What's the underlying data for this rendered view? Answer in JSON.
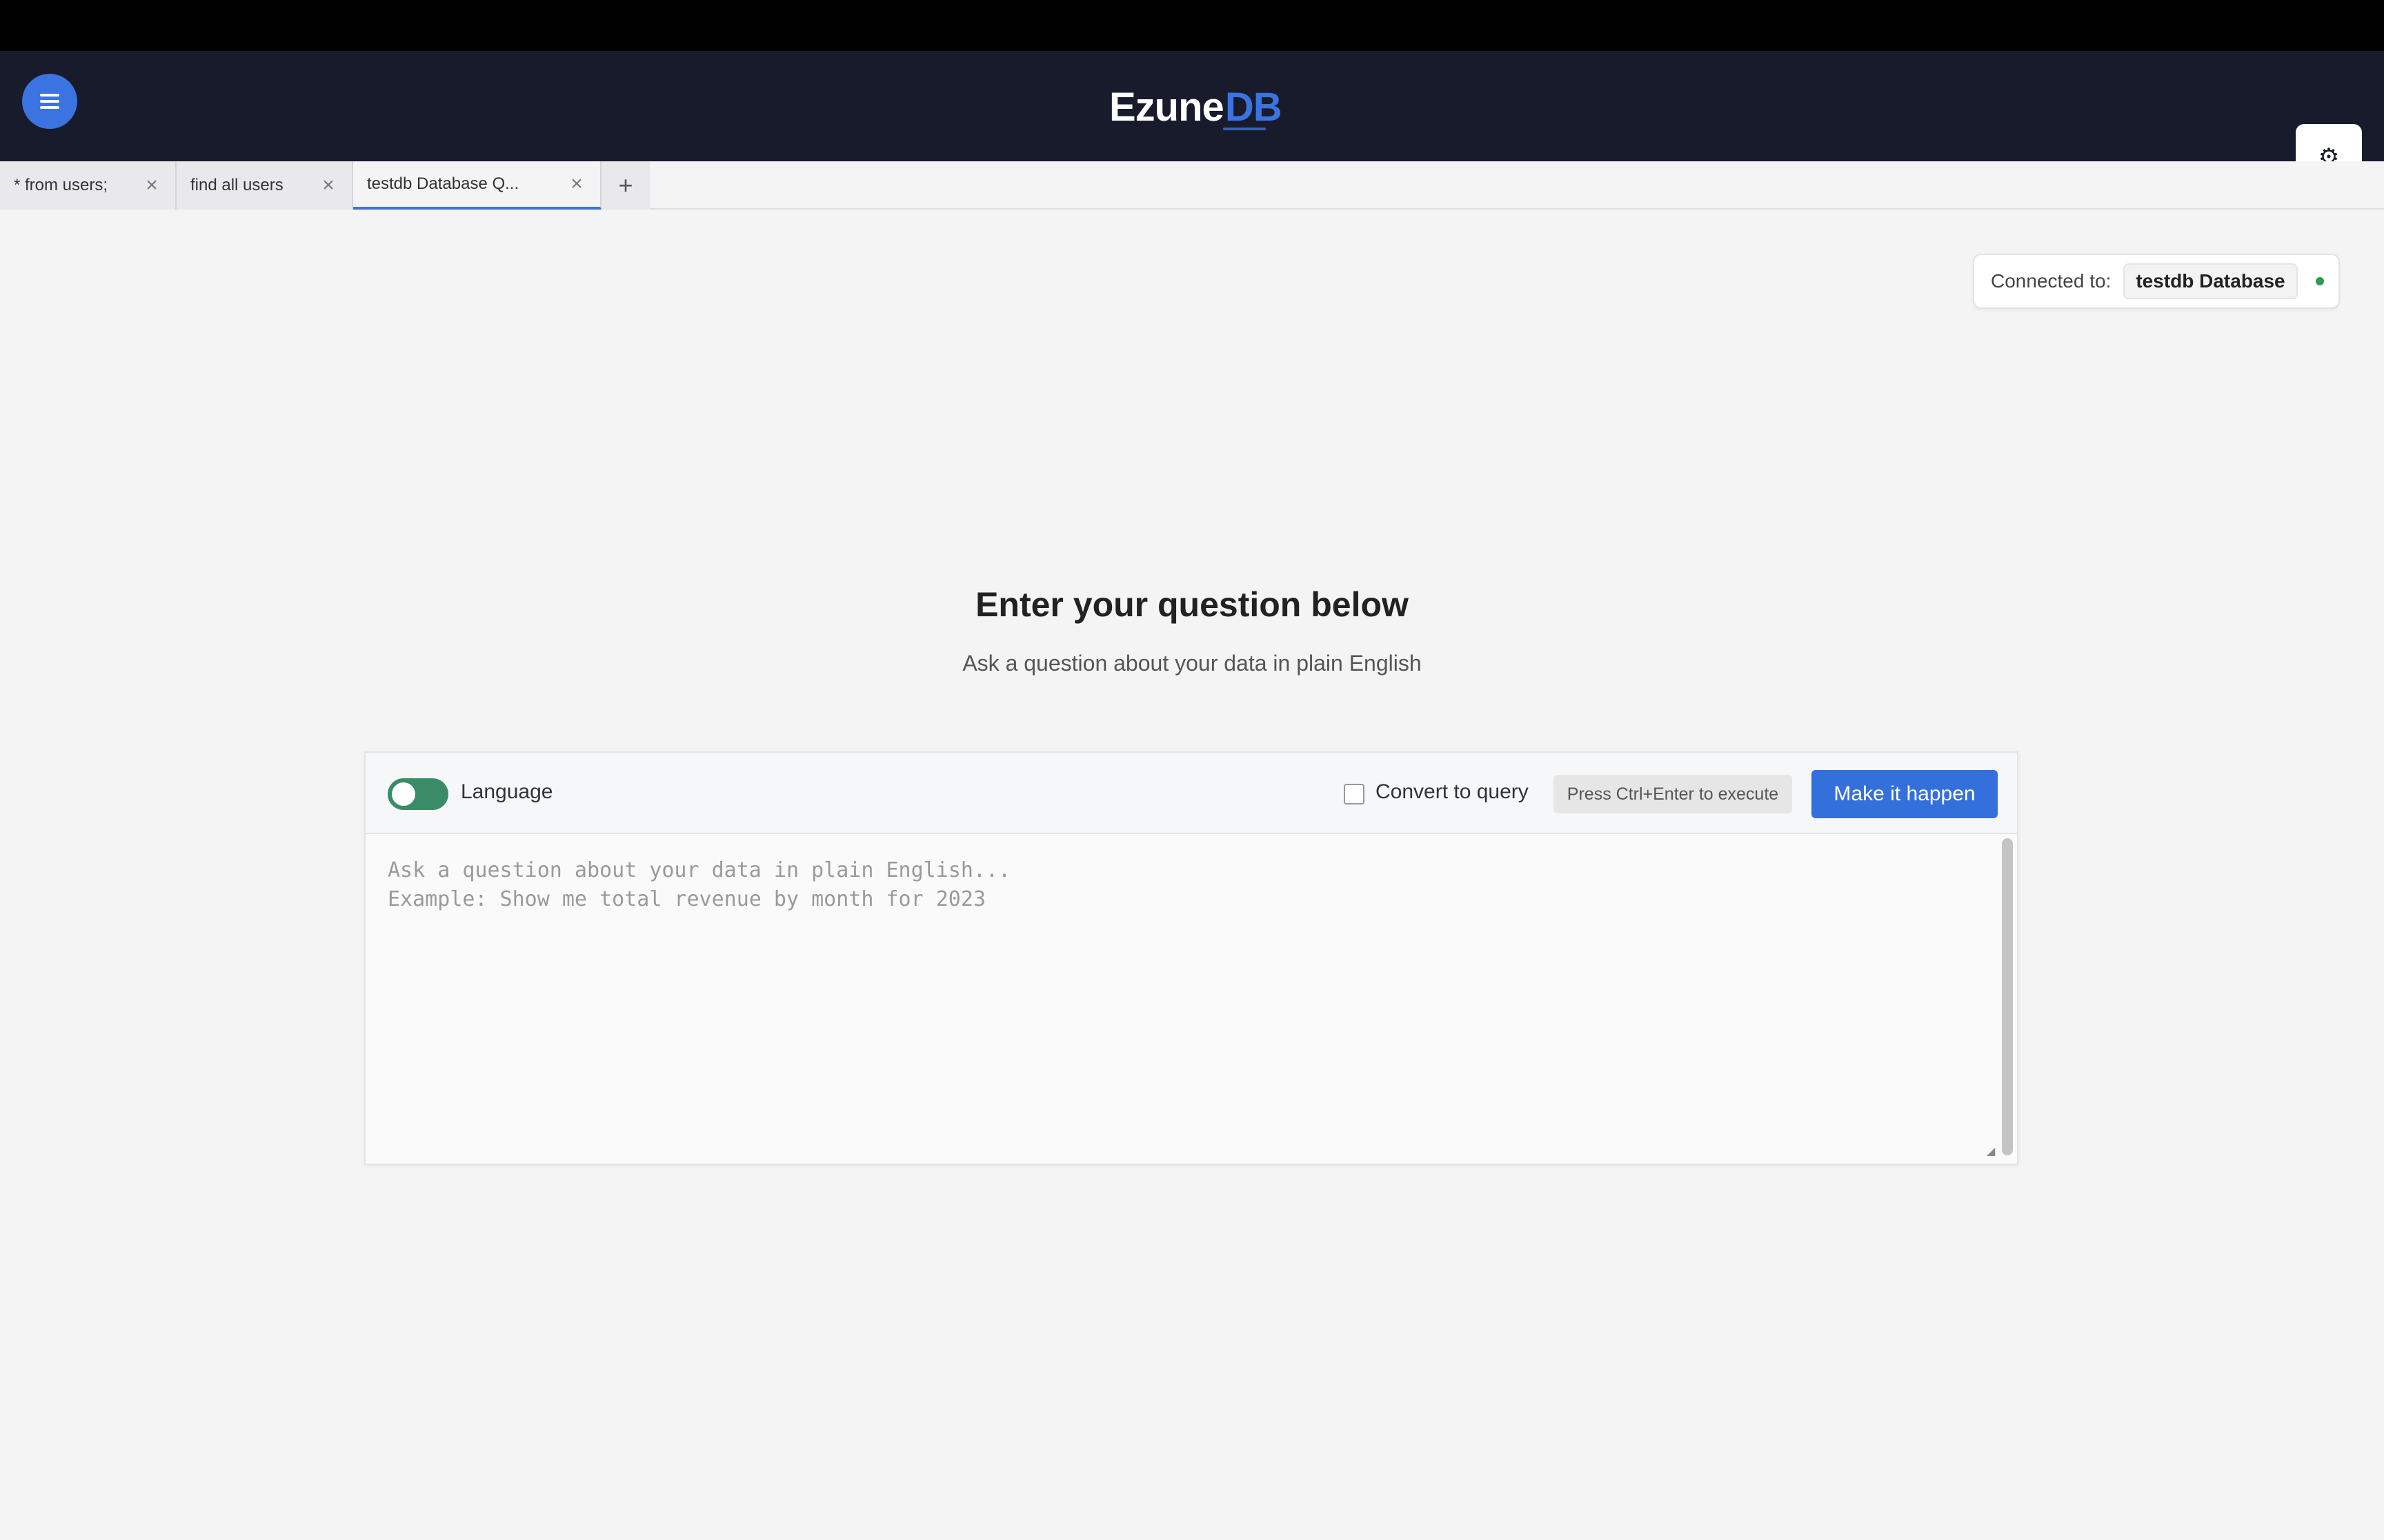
{
  "header": {
    "logo_part1": "Ezune",
    "logo_part2": "DB",
    "menu_icon": "hamburger-icon",
    "settings_icon": "gear-icon"
  },
  "tabs": [
    {
      "label": "* from users;",
      "close": "×"
    },
    {
      "label": "find all users",
      "close": "×"
    },
    {
      "label": "testdb Database Q...",
      "close": "×"
    }
  ],
  "tab_add": "+",
  "connection": {
    "label": "Connected to:",
    "database": "testdb Database",
    "status_color": "#2e9a52"
  },
  "main": {
    "title": "Enter your question below",
    "subtitle": "Ask a question about your data in plain English"
  },
  "editor": {
    "toggle_label": "Language",
    "convert_label": "Convert to query",
    "shortcut_hint": "Press Ctrl+Enter to execute",
    "run_label": "Make it happen",
    "placeholder": "Ask a question about your data in plain English...\nExample: Show me total revenue by month for 2023",
    "value": ""
  },
  "colors": {
    "accent": "#3b74e0",
    "toggle_on": "#3a8c66",
    "header_bg": "#181b2c"
  }
}
